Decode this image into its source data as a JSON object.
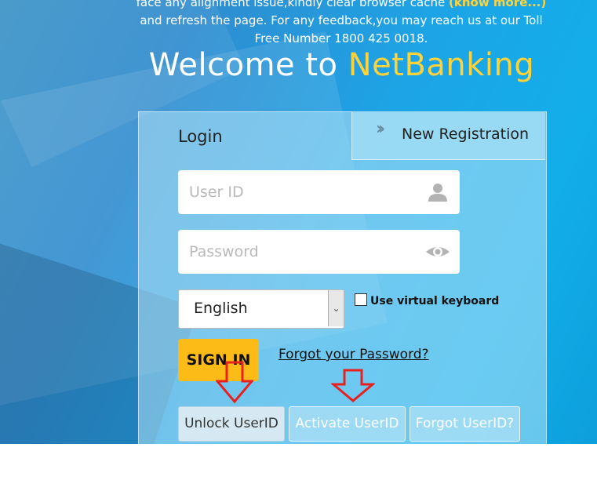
{
  "notice": {
    "line1": "face any alignment issue,kindly clear browser cache ",
    "more": "(know more...)",
    "line2": "and refresh the page. For any feedback,you may reach us at our Toll",
    "line3": "Free Number 1800 425 0018."
  },
  "welcome": {
    "prefix": "Welcome to ",
    "brand": "NetBanking"
  },
  "tabs": {
    "login": "Login",
    "new_registration": "New Registration"
  },
  "fields": {
    "user_id_placeholder": "User ID",
    "password_placeholder": "Password"
  },
  "language": {
    "selected": "English"
  },
  "virtual_keyboard": {
    "label": "Use virtual keyboard",
    "checked": false
  },
  "actions": {
    "sign_in": "SIGN IN",
    "forgot_password": "Forgot your Password?",
    "unlock_userid": "Unlock UserID",
    "activate_userid": "Activate UserID",
    "forgot_userid": "Forgot UserID?"
  },
  "icons": {
    "user_field": "user-icon",
    "password_field": "eye-icon",
    "tab_chevron": "double-chevron-right-icon"
  },
  "colors": {
    "brand_yellow": "#ffd23a",
    "signin_button": "#fcbb16",
    "annotation_arrow": "#e8201e"
  }
}
